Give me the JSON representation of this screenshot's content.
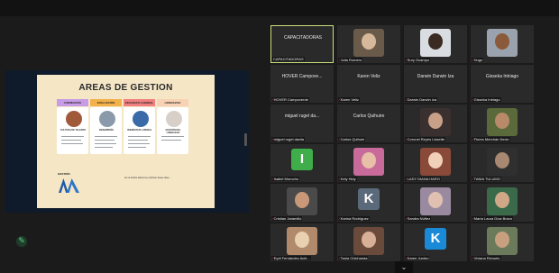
{
  "slide": {
    "title": "AREAS DE GESTION",
    "columns": [
      {
        "header": "FORMACIÓN",
        "caption": "CULTURA DE TALENTO",
        "color": "#b07ad8"
      },
      {
        "header": "EVALUACIÓN",
        "caption": "DESEMPEÑO",
        "color": "#e8a13a"
      },
      {
        "header": "FELICIDAD LABORAL",
        "caption": "BIENESTAR LABORAL",
        "color": "#e86a6a"
      },
      {
        "header": "LIDERAZGO",
        "caption": "GESTIÓN DEL LIDERAZGO",
        "color": "#f0c4a0"
      }
    ],
    "logo_label": "GESTIÓN",
    "footer_text": "En el ámbito laboral se priorizan áreas clave..."
  },
  "participants": [
    {
      "label": "CAPACITADORAS",
      "display": "CAPACITADORAS",
      "type": "text",
      "speaker": true
    },
    {
      "label": "Julia Romero",
      "type": "photo",
      "muted": true,
      "bg": "#6a5a4a",
      "face": "#d8b89a"
    },
    {
      "label": "Sury Ocampo",
      "type": "photo",
      "muted": true,
      "bg": "#d9dde2",
      "face": "#3a2a22"
    },
    {
      "label": "Hugo",
      "type": "photo",
      "muted": true,
      "bg": "#9aa3ad",
      "face": "#8a5a3a"
    },
    {
      "label": "HOVER Campoverde",
      "display": "HOVER Campove...",
      "type": "text",
      "muted": true
    },
    {
      "label": "Karen Veliz",
      "display": "Karen Veliz",
      "type": "text",
      "muted": true
    },
    {
      "label": "Darwin Darwin Iza",
      "display": "Darwin Darwin Iza",
      "type": "text",
      "muted": true
    },
    {
      "label": "Gisseka Intriago",
      "display": "Gisseka Intriago",
      "type": "text",
      "muted": true
    },
    {
      "label": "miguel rugel davila",
      "display": "miguel rugel da...",
      "type": "text",
      "muted": true
    },
    {
      "label": "Carlos Quihuiri",
      "display": "Carlos Quihuire",
      "type": "text",
      "muted": true
    },
    {
      "label": "Coronel Reyes Lissette",
      "type": "photo",
      "muted": true,
      "bg": "#3a3030",
      "face": "#c8a088"
    },
    {
      "label": "Flores Merchán Kevin",
      "type": "photo",
      "muted": true,
      "bg": "#5a6a3a",
      "face": "#b88a6a"
    },
    {
      "label": "Isabel Morocho",
      "initial": "I",
      "type": "initial",
      "muted": true,
      "bg": "#3fae4a"
    },
    {
      "label": "Kely Hidy",
      "type": "photo",
      "muted": true,
      "bg": "#c86a9a",
      "face": "#e8c0a8"
    },
    {
      "label": "LADY DIANA HARO",
      "type": "photo",
      "muted": true,
      "bg": "#8a4a3a",
      "face": "#f0d0b8"
    },
    {
      "label": "TANIA TULUMO",
      "type": "photo",
      "muted": true,
      "bg": "#2f2f2f",
      "face": "#a88870"
    },
    {
      "label": "Cristian Jaramillo",
      "type": "photo",
      "muted": true,
      "bg": "#4a4a4a",
      "face": "#c89878"
    },
    {
      "label": "Karina Rodríguez",
      "initial": "K",
      "type": "initial",
      "muted": true,
      "bg": "#5a6a7a"
    },
    {
      "label": "Sandra Núñez",
      "type": "photo",
      "muted": true,
      "bg": "#9a8aa0",
      "face": "#e0c0b0"
    },
    {
      "label": "María Laura Díaz Bravo",
      "type": "photo",
      "muted": true,
      "bg": "#3a6a4a",
      "face": "#d0a888"
    },
    {
      "label": "Eydi Fernández Acié...",
      "type": "photo",
      "muted": true,
      "bg": "#b08a6a",
      "face": "#e8d0b0"
    },
    {
      "label": "Tania Chichanda",
      "type": "photo",
      "muted": true,
      "bg": "#6a4a3a",
      "face": "#d8b098"
    },
    {
      "label": "Karen Jumbo",
      "initial": "K",
      "type": "initial",
      "muted": true,
      "bg": "#1a8ad8"
    },
    {
      "label": "Viviana Revuelo",
      "type": "photo",
      "muted": true,
      "bg": "#6a7a5a",
      "face": "#c8a080"
    }
  ],
  "icons": {
    "pen": "pen-icon",
    "chevron": "chevron-down-icon"
  }
}
